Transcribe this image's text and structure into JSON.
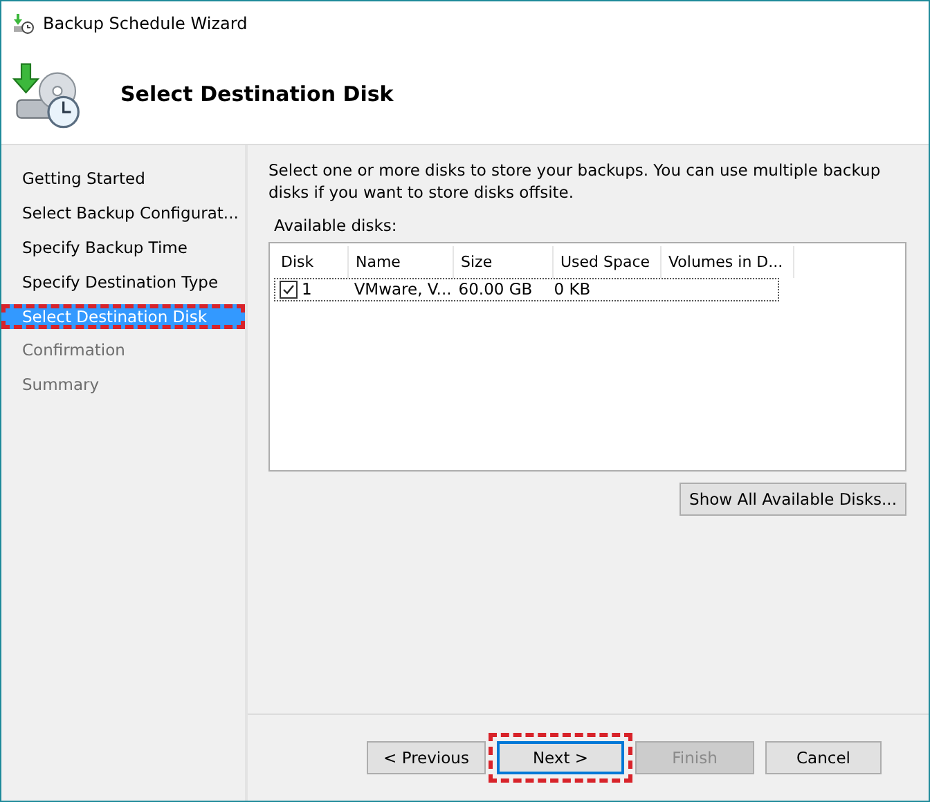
{
  "window": {
    "title": "Backup Schedule Wizard"
  },
  "header": {
    "title": "Select Destination Disk"
  },
  "steps": [
    {
      "label": "Getting Started",
      "selected": false,
      "disabled": false,
      "highlighted": false
    },
    {
      "label": "Select Backup Configurat...",
      "selected": false,
      "disabled": false,
      "highlighted": false
    },
    {
      "label": "Specify Backup Time",
      "selected": false,
      "disabled": false,
      "highlighted": false
    },
    {
      "label": "Specify Destination Type",
      "selected": false,
      "disabled": false,
      "highlighted": false
    },
    {
      "label": "Select Destination Disk",
      "selected": true,
      "disabled": false,
      "highlighted": true
    },
    {
      "label": "Confirmation",
      "selected": false,
      "disabled": true,
      "highlighted": false
    },
    {
      "label": "Summary",
      "selected": false,
      "disabled": true,
      "highlighted": false
    }
  ],
  "instructions": "Select one or more disks to store your backups. You can use multiple backup disks if you want to store disks offsite.",
  "disks_label": "Available disks:",
  "table": {
    "columns": [
      "Disk",
      "Name",
      "Size",
      "Used Space",
      "Volumes in D..."
    ],
    "rows": [
      {
        "checked": true,
        "cells": [
          "1",
          "VMware, V...",
          "60.00 GB",
          "0 KB",
          ""
        ]
      }
    ]
  },
  "show_all_button": "Show All Available Disks...",
  "buttons": [
    {
      "label": "< Previous",
      "disabled": false,
      "default": false,
      "highlighted": false
    },
    {
      "label": "Next >",
      "disabled": false,
      "default": true,
      "highlighted": true
    },
    {
      "label": "Finish",
      "disabled": true,
      "default": false,
      "highlighted": false
    },
    {
      "label": "Cancel",
      "disabled": false,
      "default": false,
      "highlighted": false
    }
  ]
}
